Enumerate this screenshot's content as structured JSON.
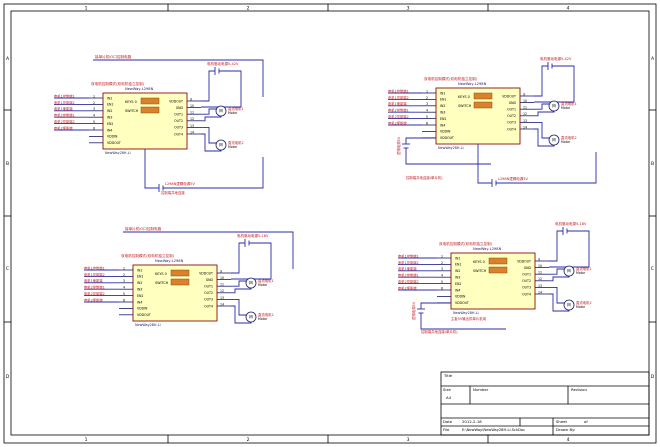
{
  "border": {
    "col_labels": [
      "1",
      "2",
      "3",
      "4"
    ],
    "row_labels": [
      "A",
      "B",
      "C",
      "D"
    ]
  },
  "title_block": {
    "title_label": "Title",
    "size_label": "Size",
    "size_value": "A4",
    "number_label": "Number",
    "revision_label": "Revision",
    "date_label": "Date",
    "date_value": "2012-2-18",
    "sheet_label": "Sheet",
    "sheet_value": "of",
    "file_label": "File",
    "file_value": "E:\\NewWay\\NewWay28H-Li.SchDoc",
    "drawn_label": "Drawn By:"
  },
  "circuits": [
    {
      "note_top": "接单片机IO口控制电路",
      "title": "双电机控制模式(双电机独立控制)",
      "chip_top": "NewWay-L298N",
      "chip_bottom": "NewWay28H-Li",
      "sw1": "KEYS 0",
      "sw2": "SWITCH",
      "inputs": [
        "电机1控制端1",
        "电机1控制端2",
        "电机1使能端",
        "电机2控制端1",
        "电机2控制端2",
        "电机2使能端"
      ],
      "left_pins": [
        "IN1",
        "EN1",
        "IN2",
        "IN3",
        "EN2",
        "IN4",
        "VDDIN",
        "VDDOUT"
      ],
      "left_nums": [
        "1",
        "2",
        "3",
        "4",
        "5",
        "6"
      ],
      "right_pins": [
        "VDDOUT",
        "GND",
        "OUT1",
        "OUT2",
        "OUT3",
        "OUT4"
      ],
      "right_nums": [
        "9",
        "10",
        "11",
        "12",
        "13",
        "14"
      ],
      "motor1": "直流电机1",
      "motor2": "直流电机2",
      "motor_sub": "Motor",
      "power": "电机驱动电源5-42V",
      "logic_power": "L298N逻辑电源5V",
      "note_bottom": "控制端共地连接"
    },
    {
      "note_top": "",
      "title": "双电机控制模式(双电机独立控制)",
      "chip_top": "NewWay-L298N",
      "chip_bottom": "NewWay28H-Li",
      "sw1": "KEYS 0",
      "sw2": "SWITCH",
      "inputs": [
        "电机1控制端1",
        "电机1控制端2",
        "电机1使能端",
        "电机2控制端1",
        "电机2控制端2",
        "电机2使能端"
      ],
      "left_pins": [
        "IN1",
        "EN1",
        "IN2",
        "IN3",
        "EN2",
        "IN4",
        "VDDIN",
        "VDDOUT"
      ],
      "left_nums": [
        "1",
        "2",
        "3",
        "4",
        "5",
        "6"
      ],
      "right_pins": [
        "VDDOUT",
        "GND",
        "OUT1",
        "OUT2",
        "OUT3",
        "OUT4"
      ],
      "right_nums": [
        "9",
        "10",
        "11",
        "12",
        "13",
        "14"
      ],
      "motor1": "直流电机1",
      "motor2": "直流电机2",
      "motor_sub": "Motor",
      "power": "电机驱动电源5-42V",
      "logic_power": "L298N逻辑电源5V",
      "side_label": "逻辑电源5V",
      "note_bottom": "控制端共地连接(单片机)"
    },
    {
      "note_top": "接单片机IO口控制电路",
      "title": "双电机控制模式(双电机独立控制)",
      "chip_top": "NewWay-L298N",
      "chip_bottom": "NewWay28H-Li",
      "sw1": "KEYS 0",
      "sw2": "SWITCH",
      "inputs": [
        "电机1控制端1",
        "电机1控制端2",
        "电机1使能端",
        "电机2控制端1",
        "电机2控制端2",
        "电机2使能端"
      ],
      "left_pins": [
        "IN1",
        "EN1",
        "IN2",
        "IN3",
        "EN2",
        "IN4",
        "VDDIN",
        "VDDOUT"
      ],
      "left_nums": [
        "1",
        "2",
        "3",
        "4",
        "5",
        "6"
      ],
      "right_pins": [
        "VDDOUT",
        "GND",
        "OUT1",
        "OUT2",
        "OUT3",
        "OUT4"
      ],
      "right_nums": [
        "9",
        "10",
        "11",
        "12",
        "13",
        "14"
      ],
      "motor1": "直流电机1",
      "motor2": "直流电机2",
      "motor_sub": "Motor",
      "power": "电机驱动电源5-18V",
      "logic_power": "",
      "note_bottom": ""
    },
    {
      "note_top": "",
      "title": "双电机控制模式(双电机独立控制)",
      "chip_top": "NewWay-L298N",
      "chip_bottom": "NewWay28H-Li",
      "sw1": "KEYS 0",
      "sw2": "SWITCH",
      "inputs": [
        "电机1控制端1",
        "电机1控制端2",
        "电机1使能端",
        "电机2控制端1",
        "电机2控制端2",
        "电机2使能端"
      ],
      "left_pins": [
        "IN1",
        "EN1",
        "IN2",
        "IN3",
        "EN2",
        "IN4",
        "VDDIN",
        "VDDOUT"
      ],
      "left_nums": [
        "1",
        "2",
        "3",
        "4",
        "5",
        "6"
      ],
      "right_pins": [
        "VDDOUT",
        "GND",
        "OUT1",
        "OUT2",
        "OUT3",
        "OUT4"
      ],
      "right_nums": [
        "9",
        "10",
        "11",
        "12",
        "13",
        "14"
      ],
      "motor1": "直流电机1",
      "motor2": "直流电机2",
      "motor_sub": "Motor",
      "power": "电机驱动电源5-18V",
      "logic_power": "",
      "side_label": "逻辑电源5V",
      "note_chip": "主板5V输出供单片机用",
      "note_bottom": "控制端共地连接(单片机)"
    }
  ]
}
